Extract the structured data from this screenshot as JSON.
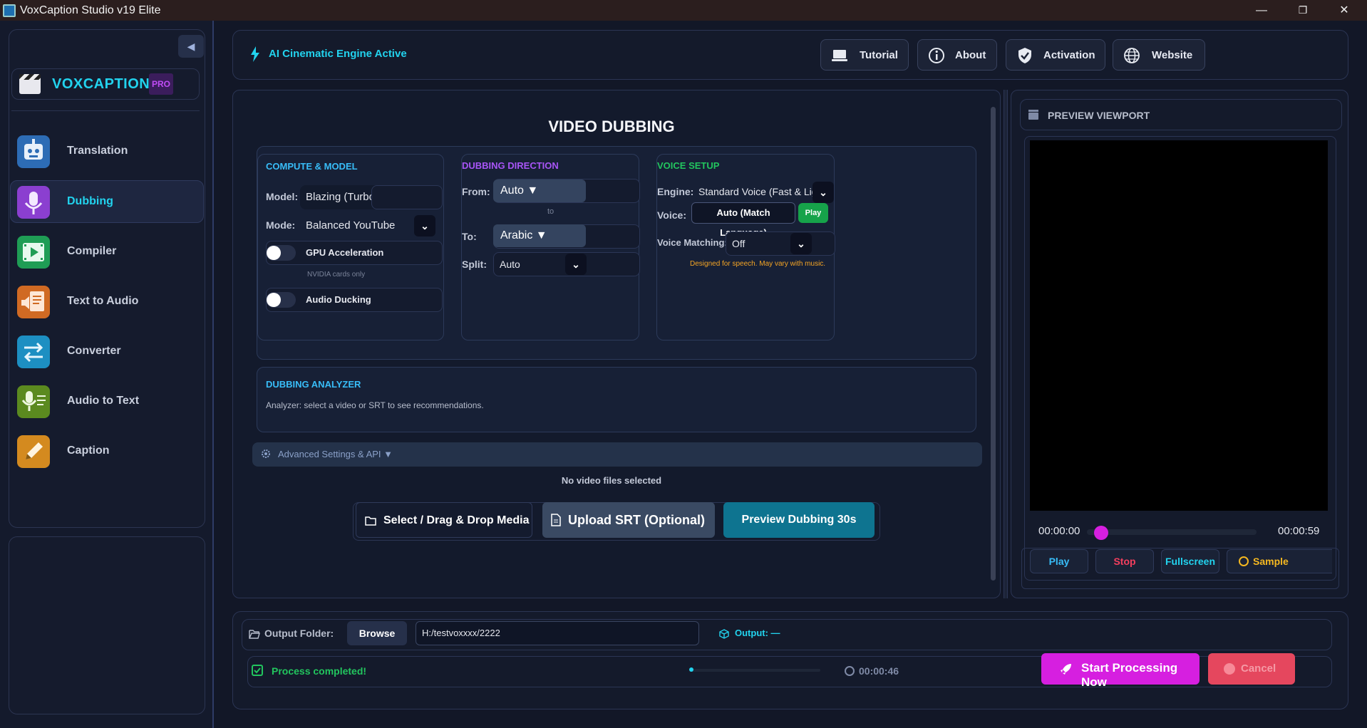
{
  "window": {
    "title": "VoxCaption Studio v19 Elite",
    "minimize": "—",
    "restore": "❐",
    "close": "✕"
  },
  "sidebar": {
    "collapse_icon": "◀",
    "brand": "VOXCAPTION",
    "badge": "PRO",
    "items": [
      {
        "label": "Translation",
        "icon": "robot-icon",
        "color": "#2d6cb5"
      },
      {
        "label": "Dubbing",
        "icon": "microphone-icon",
        "color": "#8b3fd0"
      },
      {
        "label": "Compiler",
        "icon": "film-play-icon",
        "color": "#1f9d55"
      },
      {
        "label": "Text to Audio",
        "icon": "document-speaker-icon",
        "color": "#d06a23"
      },
      {
        "label": "Converter",
        "icon": "arrows-swap-icon",
        "color": "#1d8fc2"
      },
      {
        "label": "Audio to Text",
        "icon": "mic-text-icon",
        "color": "#5b8a1f"
      },
      {
        "label": "Caption",
        "icon": "pencil-icon",
        "color": "#d48a1f"
      }
    ],
    "active": "Dubbing"
  },
  "topbar": {
    "status": "AI Cinematic Engine Active",
    "buttons": {
      "tutorial": "Tutorial",
      "about": "About",
      "activation": "Activation",
      "website": "Website"
    }
  },
  "main": {
    "title": "VIDEO DUBBING",
    "compute": {
      "heading": "COMPUTE & MODEL",
      "model_label": "Model:",
      "model_value": "Blazing (Turbo)",
      "mode_label": "Mode:",
      "mode_value": "Balanced YouTube",
      "gpu_label": "GPU Acceleration",
      "gpu_note": "NVIDIA cards only",
      "ducking_label": "Audio Ducking"
    },
    "direction": {
      "heading": "DUBBING DIRECTION",
      "from_label": "From:",
      "from_value": "Auto ▼",
      "to_sep": "to",
      "to_label": "To:",
      "to_value": "Arabic ▼",
      "split_label": "Split:",
      "split_value": "Auto"
    },
    "voice": {
      "heading": "VOICE SETUP",
      "engine_label": "Engine:",
      "engine_value": "Standard Voice (Fast & Light)",
      "voice_label": "Voice:",
      "voice_value": "Auto (Match Language)",
      "play": "Play",
      "matching_label": "Voice Matching:",
      "matching_value": "Off",
      "note": "Designed for speech. May vary with music."
    },
    "analyzer": {
      "heading": "DUBBING ANALYZER",
      "text": "Analyzer: select a video or SRT to see recommendations."
    },
    "advanced": "Advanced Settings & API  ▼",
    "no_files": "No video files selected",
    "actions": {
      "select": "Select / Drag & Drop Media",
      "upload": "Upload SRT (Optional)",
      "preview": "Preview Dubbing 30s"
    },
    "chevron": "⌄"
  },
  "preview": {
    "heading": "PREVIEW VIEWPORT",
    "time_start": "00:00:00",
    "time_end": "00:00:59",
    "progress": 0.0,
    "buttons": {
      "play": "Play",
      "stop": "Stop",
      "fullscreen": "Fullscreen",
      "sample": "Sample"
    }
  },
  "bottom": {
    "output_label": "Output Folder:",
    "browse": "Browse",
    "path": "H:/testvoxxxx/2222",
    "output_status": "Output: —",
    "status": "Process completed!",
    "elapsed": "00:00:46",
    "start": "Start Processing Now",
    "cancel": "Cancel"
  },
  "colors": {
    "accent": "#22d3ee",
    "magenta": "#d61fe0",
    "green": "#22c55e",
    "red": "#e5475e"
  }
}
